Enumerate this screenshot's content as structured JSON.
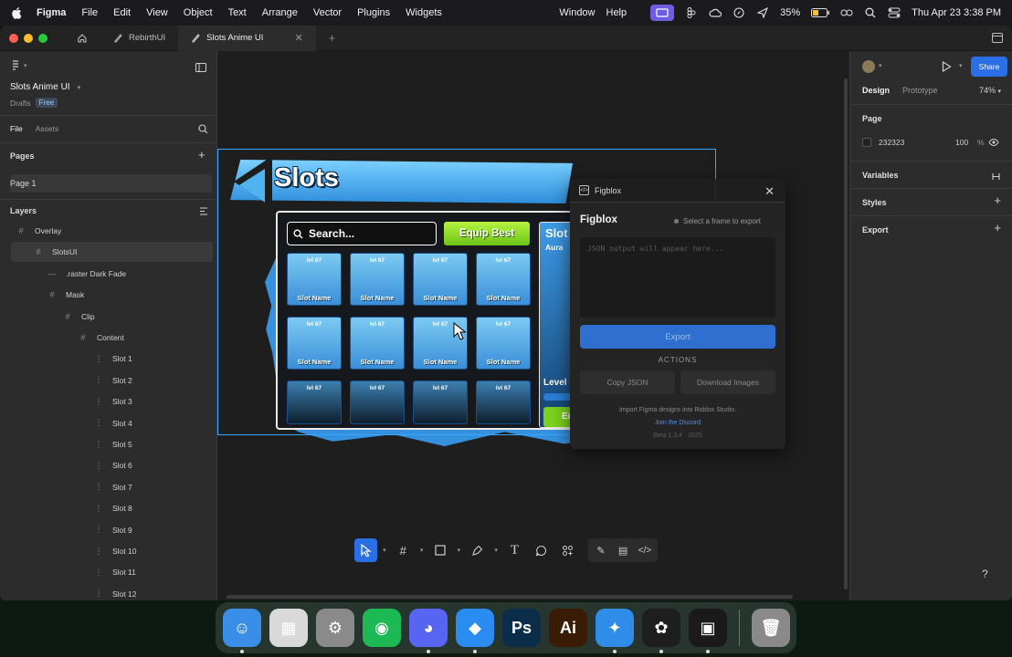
{
  "menubar": {
    "app": "Figma",
    "items": [
      "File",
      "Edit",
      "View",
      "Object",
      "Text",
      "Arrange",
      "Vector",
      "Plugins",
      "Widgets"
    ],
    "right_items": [
      "Window",
      "Help"
    ],
    "battery": "35%",
    "clock": "Thu Apr 23  3:38 PM"
  },
  "tabs": [
    {
      "label": "RebirthUI"
    },
    {
      "label": "Slots Anime UI"
    }
  ],
  "left": {
    "file_name": "Slots Anime UI",
    "drafts": "Drafts",
    "badge": "Free",
    "tab_file": "File",
    "tab_assets": "Assets",
    "pages_title": "Pages",
    "page1": "Page 1",
    "layers_title": "Layers",
    "layers": [
      {
        "label": "Overlay",
        "icon": "#",
        "indent": 0
      },
      {
        "label": "SlotsUI",
        "icon": "#",
        "indent": 1
      },
      {
        "label": ".raster Dark Fade",
        "icon": "—",
        "indent": 2
      },
      {
        "label": "Mask",
        "icon": "#",
        "indent": 2
      },
      {
        "label": "Clip",
        "icon": "#",
        "indent": 3
      },
      {
        "label": "Content",
        "icon": "#",
        "indent": 4
      },
      {
        "label": "Slot 1",
        "icon": "⋮",
        "indent": 5
      },
      {
        "label": "Slot 2",
        "icon": "⋮",
        "indent": 5
      },
      {
        "label": "Slot 3",
        "icon": "⋮",
        "indent": 5
      },
      {
        "label": "Slot 4",
        "icon": "⋮",
        "indent": 5
      },
      {
        "label": "Slot 5",
        "icon": "⋮",
        "indent": 5
      },
      {
        "label": "Slot 6",
        "icon": "⋮",
        "indent": 5
      },
      {
        "label": "Slot 7",
        "icon": "⋮",
        "indent": 5
      },
      {
        "label": "Slot 8",
        "icon": "⋮",
        "indent": 5
      },
      {
        "label": "Slot 9",
        "icon": "⋮",
        "indent": 5
      },
      {
        "label": "Slot 10",
        "icon": "⋮",
        "indent": 5
      },
      {
        "label": "Slot 11",
        "icon": "⋮",
        "indent": 5
      },
      {
        "label": "Slot 12",
        "icon": "⋮",
        "indent": 5
      }
    ]
  },
  "game": {
    "title": "Slots",
    "search": "Search...",
    "equip": "Equip Best",
    "slot_level": "lvl 67",
    "slot_name": "Slot Name",
    "side_title": "Slot",
    "side_sub": "Aura",
    "side_level": "Level",
    "side_btn": "Eq"
  },
  "plugin": {
    "window_title": "Figblox",
    "title": "Figblox",
    "status": "Select a frame to export",
    "placeholder": "JSON output will appear here...",
    "export": "Export",
    "actions": "ACTIONS",
    "copy_json": "Copy JSON",
    "download_images": "Download Images",
    "foot1": "Import Figma designs into Roblox Studio.",
    "foot2": "Join the Discord",
    "foot3": "Beta 1.3.4 · 2025"
  },
  "right": {
    "share": "Share",
    "tab_design": "Design",
    "tab_prototype": "Prototype",
    "zoom": "74%",
    "page_title": "Page",
    "page_color": "232323",
    "page_opacity": "100",
    "page_pct": "%",
    "variables": "Variables",
    "styles": "Styles",
    "export": "Export"
  },
  "colors": {
    "accent": "#2a6fe6",
    "frame_border": "#3aa6ff",
    "canvas": "#1e1e1e",
    "panel": "#2c2c2c"
  },
  "dock": [
    {
      "name": "Finder",
      "glyph": "☺",
      "color": "#3a8ee8",
      "running": true
    },
    {
      "name": "Launchpad",
      "glyph": "▦",
      "color": "#d9d9d9",
      "running": false
    },
    {
      "name": "System Settings",
      "glyph": "⚙",
      "color": "#8a8a8a",
      "running": false
    },
    {
      "name": "Spotify",
      "glyph": "◉",
      "color": "#1db954",
      "running": false
    },
    {
      "name": "Discord",
      "glyph": "◕",
      "color": "#5865f2",
      "running": true
    },
    {
      "name": "Roblox Studio",
      "glyph": "◆",
      "color": "#2a8cf0",
      "running": true
    },
    {
      "name": "Photoshop",
      "glyph": "Ps",
      "color": "#0c2d4a",
      "running": false
    },
    {
      "name": "Illustrator",
      "glyph": "Ai",
      "color": "#3a1c06",
      "running": false
    },
    {
      "name": "Safari",
      "glyph": "✦",
      "color": "#2f8ce8",
      "running": true
    },
    {
      "name": "Figma",
      "glyph": "✿",
      "color": "#1e1e1e",
      "running": true
    },
    {
      "name": "Roblox",
      "glyph": "▣",
      "color": "#1a1a1a",
      "running": true
    },
    {
      "name": "Trash",
      "glyph": "🗑",
      "color": "#8a8a8a",
      "running": false
    }
  ]
}
